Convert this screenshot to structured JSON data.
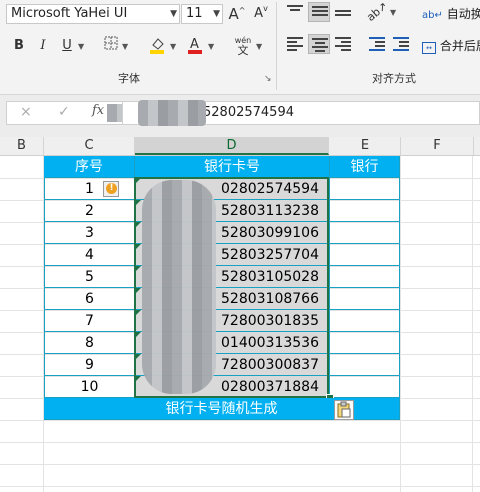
{
  "ribbon": {
    "font_name": "Microsoft YaHei UI",
    "font_size": "11",
    "grow_font": "A",
    "shrink_font": "A",
    "bold": "B",
    "italic": "I",
    "underline": "U",
    "phonetic_top": "wén",
    "phonetic_bottom": "文",
    "font_group_label": "字体",
    "align_group_label": "对齐方式",
    "wrap_text_label": "自动换行",
    "merge_label": "合并后居",
    "font_color_hex": "#e02020",
    "fill_color_hex": "#ffd400"
  },
  "formula_bar": {
    "fx": "fx",
    "cancel": "×",
    "enter": "✓",
    "value_visible": "52802574594"
  },
  "columns": [
    "B",
    "C",
    "D",
    "E",
    "F"
  ],
  "table": {
    "headers": [
      "序号",
      "银行卡号",
      "银行"
    ],
    "rows": [
      {
        "seq": "1",
        "card": "02802574594"
      },
      {
        "seq": "2",
        "card": "52803113238"
      },
      {
        "seq": "3",
        "card": "52803099106"
      },
      {
        "seq": "4",
        "card": "52803257704"
      },
      {
        "seq": "5",
        "card": "52803105028"
      },
      {
        "seq": "6",
        "card": "52803108766"
      },
      {
        "seq": "7",
        "card": "72800301835"
      },
      {
        "seq": "8",
        "card": "01400313536"
      },
      {
        "seq": "9",
        "card": "72800300837"
      },
      {
        "seq": "10",
        "card": "02800371884"
      }
    ],
    "footer": "银行卡号随机生成",
    "header_color": "#00b0f0",
    "warning_symbol": "!"
  }
}
